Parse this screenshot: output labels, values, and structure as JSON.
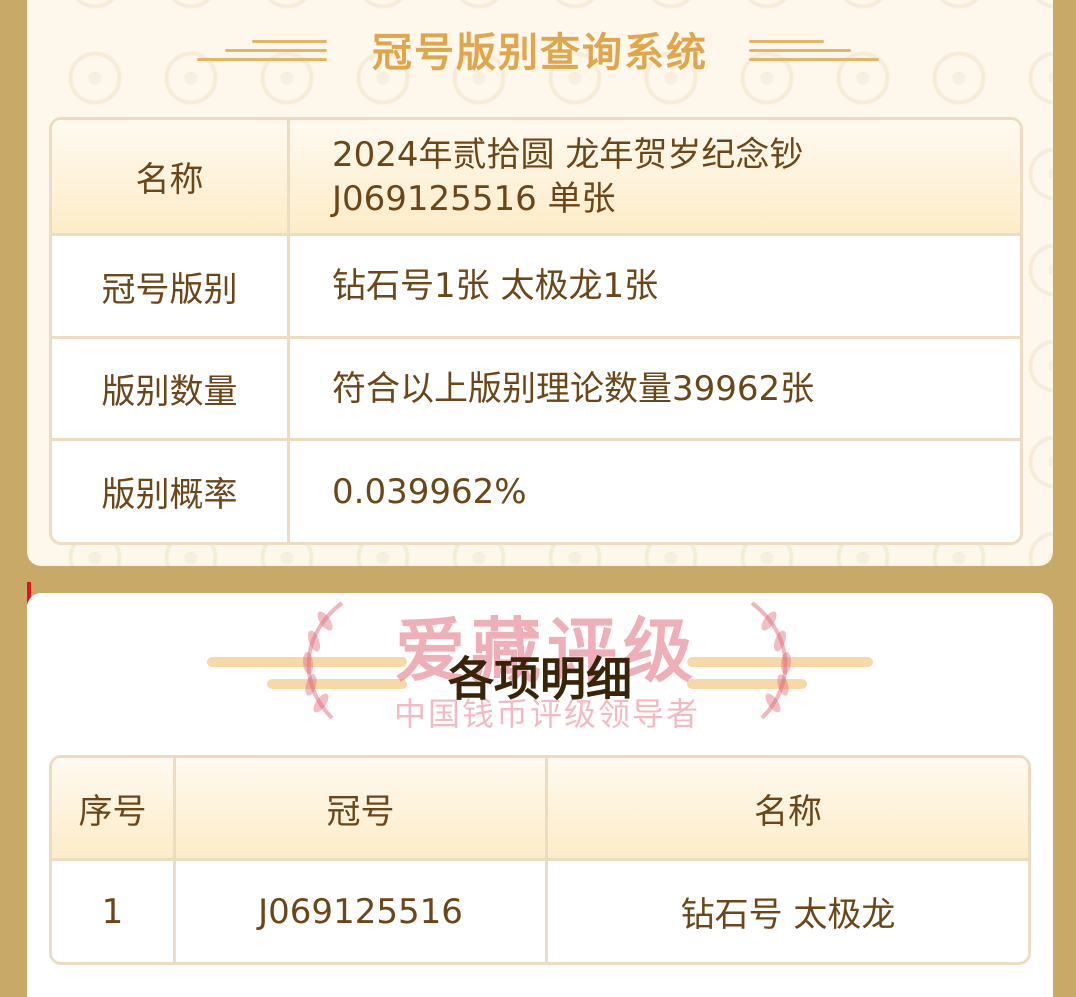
{
  "header": {
    "title": "冠号版别查询系统"
  },
  "info": {
    "rows": [
      {
        "key": "名称",
        "value": "2024年贰拾圆 龙年贺岁纪念钞\nJ069125516 单张"
      },
      {
        "key": "冠号版别",
        "value": "钻石号1张 太极龙1张"
      },
      {
        "key": "版别数量",
        "value": "符合以上版别理论数量39962张"
      },
      {
        "key": "版别概率",
        "value": "0.039962%"
      }
    ]
  },
  "watermark": {
    "main": "爱藏评级",
    "sub": "中国钱币评级领导者"
  },
  "details": {
    "title": "各项明细",
    "columns": [
      "序号",
      "冠号",
      "名称"
    ],
    "rows": [
      [
        "1",
        "J069125516",
        "钻石号 太极龙"
      ]
    ]
  },
  "colors": {
    "frame": "#c9a968",
    "title_gold": "#e0a64b",
    "text_brown": "#6b4618",
    "accent_red": "#e0151b"
  }
}
